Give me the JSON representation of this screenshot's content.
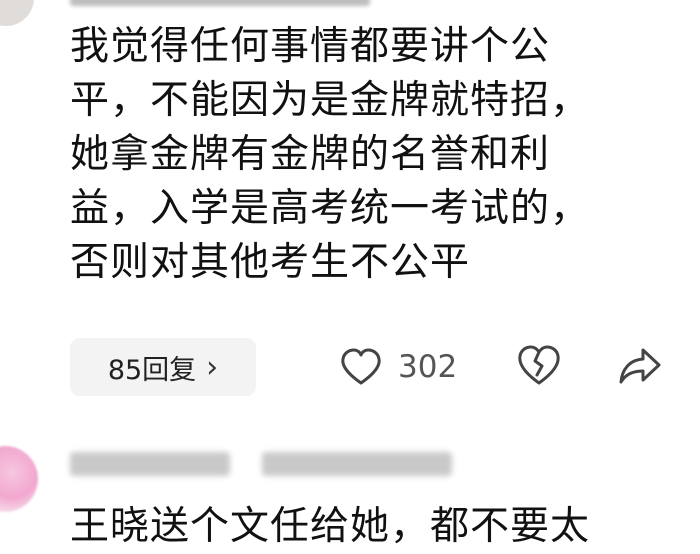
{
  "comment": {
    "lines": [
      "我觉得任何事情都要讲个公",
      "平，不能因为是金牌就特招，",
      "她拿金牌有金牌的名誉和利",
      "益，入学是高考统一考试的，",
      "否则对其他考生不公平"
    ],
    "reply_count": "85回复",
    "reply_chevron": "›",
    "likes": "302"
  },
  "next_comment": {
    "partial_text": "王晓送个文任给她，都不要太"
  },
  "icons": {
    "like": "heart-outline-icon",
    "dislike": "broken-heart-icon",
    "share": "share-arrow-icon"
  },
  "colors": {
    "text": "#111111",
    "muted": "#555555",
    "pill_bg": "#f3f3f3",
    "avatar_pink": "#f2a7cf"
  }
}
